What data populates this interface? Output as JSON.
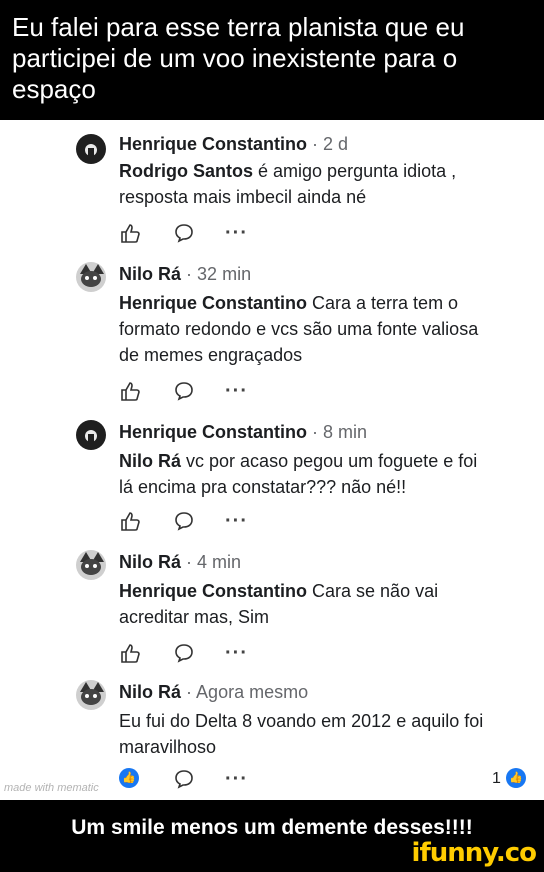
{
  "top_caption": "Eu falei para esse terra planista que eu participei de um voo inexistente para o espaço",
  "comments": [
    {
      "author": "Henrique Constantino",
      "time": "2 d",
      "mention": "Rodrigo Santos",
      "lines": [
        "é  amigo pergunta idiota ,",
        "resposta mais imbecil ainda né"
      ]
    },
    {
      "author": "Nilo Rá",
      "time": "32 min",
      "mention": "Henrique Constantino",
      "lines": [
        "Cara a terra tem o",
        "formato redondo e vcs são uma fonte valiosa",
        "de memes engraçados"
      ]
    },
    {
      "author": "Henrique Constantino",
      "time": "8 min",
      "mention": "Nilo Rá",
      "lines": [
        "vc por acaso pegou um foguete e foi",
        "lá encima  pra constatar??? não né!!"
      ]
    },
    {
      "author": "Nilo Rá",
      "time": "4 min",
      "mention": "Henrique Constantino",
      "lines": [
        "Cara se não vai",
        "acreditar mas, Sim"
      ]
    },
    {
      "author": "Nilo Rá",
      "time": "Agora mesmo",
      "mention": "",
      "lines": [
        "Eu fui do Delta 8 voando em 2012 e aquilo foi",
        "maravilhoso"
      ]
    }
  ],
  "separator": "·",
  "more_label": "···",
  "last_reaction_count": "1",
  "watermark": "made with mematic",
  "bottom_caption": "Um smile menos um demente desses!!!!",
  "ifunny_logo": "ifunny.co",
  "icons": [
    "like-icon",
    "comment-icon",
    "more-icon",
    "avatar"
  ],
  "colors": {
    "banner": "#000000",
    "text": "#1c1e21",
    "muted": "#65676b",
    "like_blue": "#1877f2",
    "ifunny_yellow": "#ffcc00"
  }
}
